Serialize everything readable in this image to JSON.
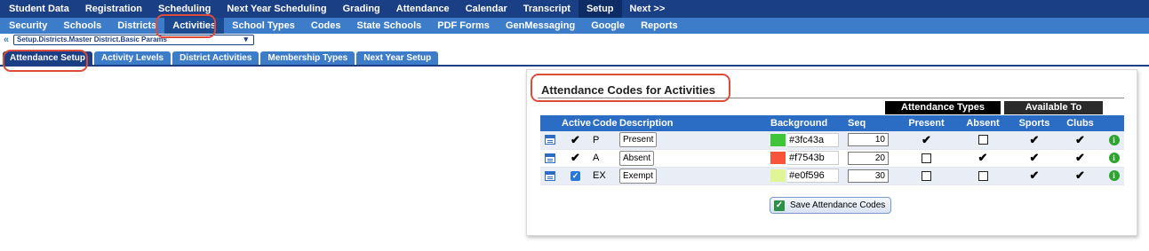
{
  "top_menu": {
    "items": [
      "Student Data",
      "Registration",
      "Scheduling",
      "Next Year Scheduling",
      "Grading",
      "Attendance",
      "Calendar",
      "Transcript",
      "Setup",
      "Next >>"
    ],
    "active_index": 8
  },
  "sub_menu": {
    "items": [
      "Security",
      "Schools",
      "Districts",
      "Activities",
      "School Types",
      "Codes",
      "State Schools",
      "PDF Forms",
      "GenMessaging",
      "Google",
      "Reports"
    ],
    "active_index": 3
  },
  "breadcrumb": {
    "chevron": "«",
    "value": "Setup.Districts.Master District.Basic Params",
    "arrow": "▾"
  },
  "tabs": {
    "items": [
      "Attendance Setup",
      "Activity Levels",
      "District Activities",
      "Membership Types",
      "Next Year Setup"
    ],
    "active_index": 0
  },
  "panel": {
    "title": "Attendance Codes for Activities",
    "group_attendance_types": "Attendance Types",
    "group_available_to": "Available To",
    "columns": {
      "active": "Active",
      "code": "Code",
      "description": "Description",
      "background": "Background",
      "seq": "Seq",
      "present": "Present",
      "absent": "Absent",
      "sports": "Sports",
      "clubs": "Clubs"
    },
    "rows": [
      {
        "code": "P",
        "description": "Present",
        "background": "#3fc43a",
        "seq": "10",
        "active": "check",
        "present": true,
        "absent": false,
        "sports": true,
        "clubs": true
      },
      {
        "code": "A",
        "description": "Absent",
        "background": "#f7543b",
        "seq": "20",
        "active": "check",
        "present": false,
        "absent": true,
        "sports": true,
        "clubs": true
      },
      {
        "code": "EX",
        "description": "Exempt",
        "background": "#e0f596",
        "seq": "30",
        "active": "checkbox",
        "present": false,
        "absent": false,
        "sports": true,
        "clubs": true
      }
    ],
    "save_button": "Save Attendance Codes"
  },
  "colors": {
    "top_menu_bg": "#1b3f84",
    "sub_menu_bg": "#3d7cc9",
    "table_header_bg": "#2b6cc4",
    "highlight": "#dd4b3a"
  }
}
